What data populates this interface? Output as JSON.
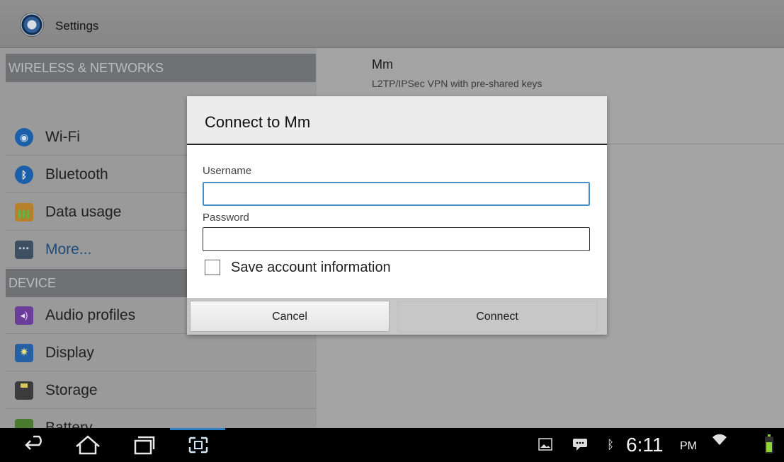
{
  "app": {
    "title": "Settings"
  },
  "sidebar": {
    "sections": [
      {
        "header": "WIRELESS & NETWORKS"
      },
      {
        "header": "DEVICE"
      }
    ],
    "items": [
      {
        "label": "Wi-Fi",
        "icon": "wifi-icon"
      },
      {
        "label": "Bluetooth",
        "icon": "bluetooth-icon"
      },
      {
        "label": "Data usage",
        "icon": "data-usage-icon"
      },
      {
        "label": "More...",
        "icon": "more-icon"
      },
      {
        "label": "Audio profiles",
        "icon": "audio-profiles-icon"
      },
      {
        "label": "Display",
        "icon": "display-icon"
      },
      {
        "label": "Storage",
        "icon": "storage-icon"
      },
      {
        "label": "Battery",
        "icon": "battery-icon"
      }
    ]
  },
  "vpn": {
    "name": "Mm",
    "type": "L2TP/IPSec VPN with pre-shared keys"
  },
  "dialog": {
    "title": "Connect to Mm",
    "username_label": "Username",
    "username_value": "",
    "password_label": "Password",
    "password_value": "",
    "save_account_label": "Save account information",
    "save_account_checked": false,
    "cancel_label": "Cancel",
    "connect_label": "Connect"
  },
  "statusbar": {
    "time": "6:11",
    "ampm": "PM",
    "icons": [
      "gallery-icon",
      "message-icon",
      "bluetooth-icon",
      "wifi-signal-icon",
      "battery-icon"
    ]
  },
  "colors": {
    "accent_blue": "#4a90c8",
    "section_header_bg": "#707173",
    "nav_highlight": "#2a7fc8"
  }
}
